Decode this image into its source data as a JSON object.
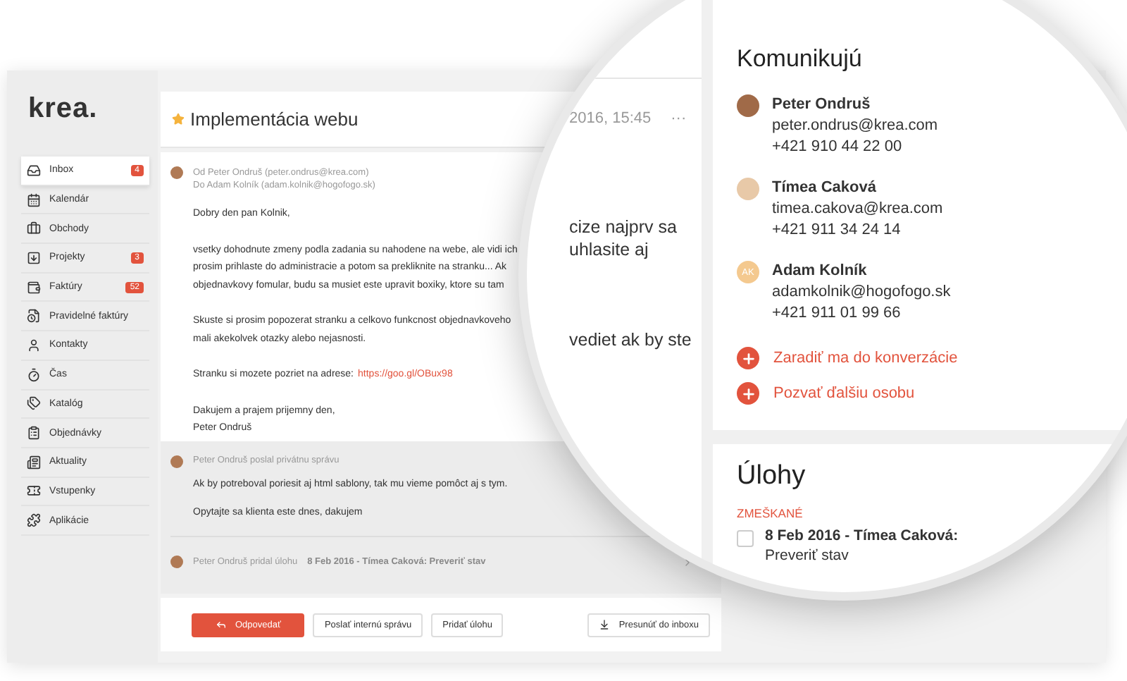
{
  "logo": "krea.",
  "sidebar": {
    "items": [
      {
        "label": "Inbox",
        "badge": "4",
        "selected": true
      },
      {
        "label": "Kalendár",
        "selected": false
      },
      {
        "label": "Obchody",
        "selected": false
      },
      {
        "label": "Projekty",
        "badge": "3",
        "selected": false
      },
      {
        "label": "Faktúry",
        "badge": "52",
        "selected": false
      },
      {
        "label": "Pravidelné faktúry",
        "selected": false
      },
      {
        "label": "Kontakty",
        "selected": false
      },
      {
        "label": "Čas",
        "selected": false
      },
      {
        "label": "Katalóg",
        "selected": false
      },
      {
        "label": "Objednávky",
        "selected": false
      },
      {
        "label": "Aktuality",
        "selected": false
      },
      {
        "label": "Vstupenky",
        "selected": false
      },
      {
        "label": "Aplikácie",
        "selected": false
      }
    ]
  },
  "conversation": {
    "title": "Implementácia webu",
    "starred": true,
    "message": {
      "from": "Od Peter Ondruš (peter.ondrus@krea.com)",
      "to": "Do Adam Kolník (adam.kolnik@hogofogo.sk)",
      "paragraphs": [
        {
          "kind": "text",
          "lines": [
            "Dobry den pan Kolnik,"
          ]
        },
        {
          "kind": "text",
          "lines": [
            "vsetky dohodnute zmeny podla zadania su nahodene na webe, ale vidi ich",
            "prosim prihlaste do administracie a potom sa prekliknite na stranku... Ak",
            "objednavkovy fomular, budu sa musiet este upravit boxiky, ktore su tam"
          ]
        },
        {
          "kind": "text",
          "lines": [
            "Skuste si prosim popozerat stranku a celkovo funkcnost objednavkoveho",
            "mali akekolvek otazky alebo nejasnosti."
          ]
        },
        {
          "kind": "link",
          "text": "Stranku si mozete pozriet na adrese:",
          "url": "https://goo.gl/OBux98"
        },
        {
          "kind": "text",
          "lines": [
            "Dakujem a prajem prijemny den,",
            "Peter Ondruš"
          ]
        }
      ]
    },
    "private_note": {
      "header": "Peter Ondruš poslal privátnu správu",
      "lines": [
        "Ak by potreboval poriesit aj html sablony, tak mu vieme pomôct aj s tym.",
        "Opytajte sa klienta este dnes, dakujem"
      ]
    },
    "activity": {
      "text": "Peter Ondruš pridal úlohu",
      "task": "8 Feb 2016 - Tímea Caková: Preveriť stav"
    },
    "buttons": [
      {
        "label": "Odpovedať",
        "kind": "primary"
      },
      {
        "label": "Poslať internú správu",
        "kind": "secondary"
      },
      {
        "label": "Pridať úlohu",
        "kind": "secondary"
      }
    ],
    "move_button": "Presunúť do inboxu"
  },
  "magnifier": {
    "date": "2016, 15:45",
    "menu": "···",
    "fragments": [
      "cize najprv sa",
      "uhlasite aj",
      "vediet ak by ste"
    ],
    "participants": {
      "title": "Komunikujú",
      "people": [
        {
          "name": "Peter Ondruš",
          "email": "peter.ondrus@krea.com",
          "phone": "+421 910 44 22 00",
          "kind": "photo"
        },
        {
          "name": "Tímea Caková",
          "email": "timea.cakova@krea.com",
          "phone": "+421 911 34 24 14",
          "kind": "photo"
        },
        {
          "name": "Adam Kolník",
          "email": "adamkolnik@hogofogo.sk",
          "phone": "+421 911 01 99 66",
          "kind": "initials",
          "initials": "AK"
        }
      ],
      "actions": [
        "Zaradiť ma do konverzácie",
        "Pozvať ďalšiu osobu"
      ]
    },
    "tasks": {
      "title": "Úlohy",
      "group": "ZMEŠKANÉ",
      "items": [
        {
          "title": "8 Feb 2016 - Tímea Caková:",
          "detail": "Preveriť stav",
          "checked": false
        }
      ]
    }
  }
}
